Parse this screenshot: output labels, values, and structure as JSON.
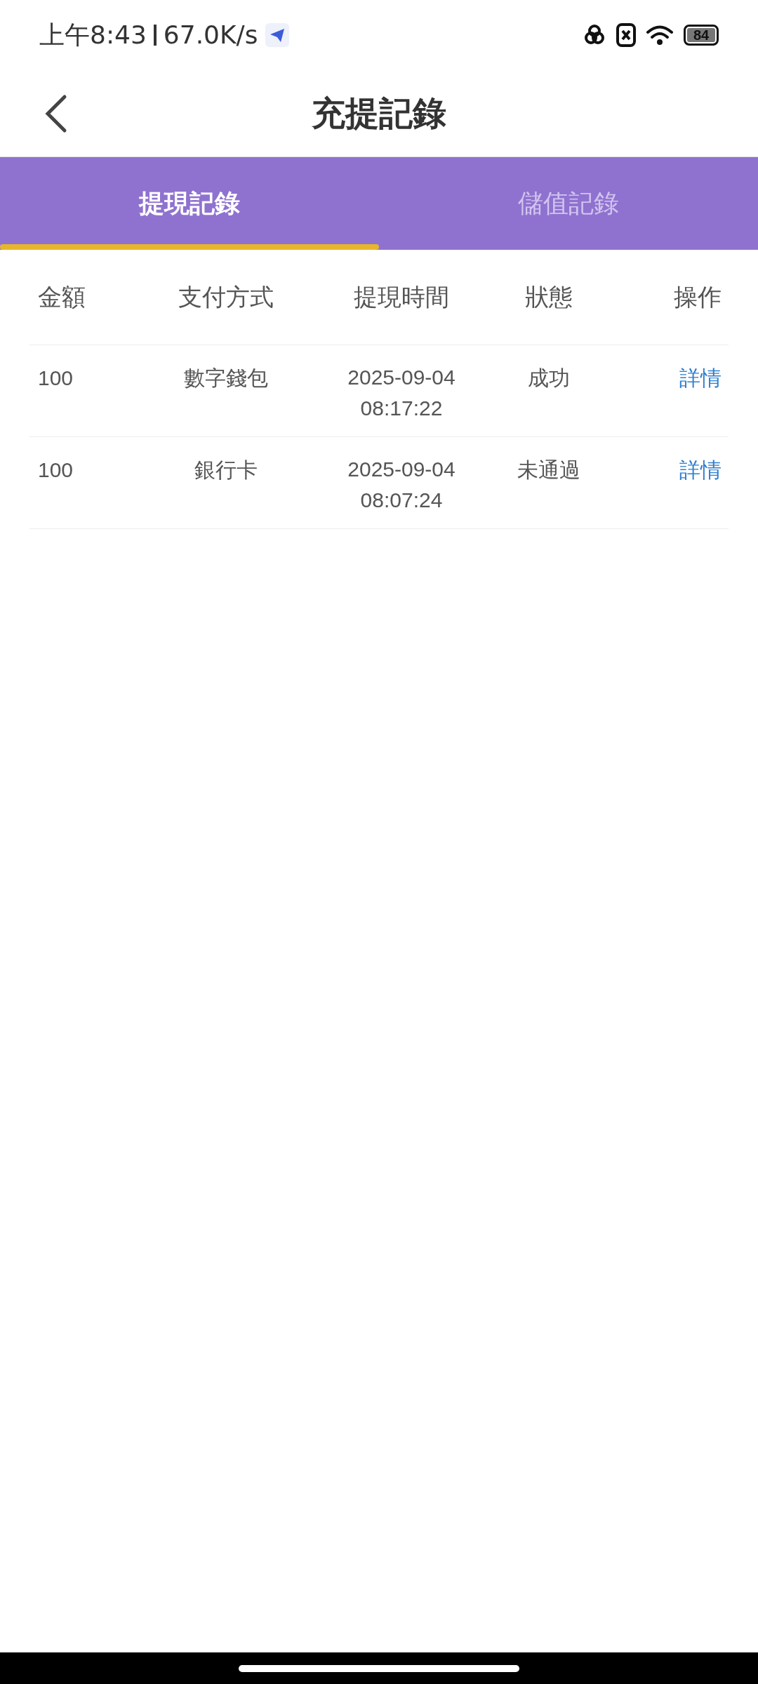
{
  "status_bar": {
    "time": "上午8:43",
    "speed": "67.0K/s",
    "battery": "84"
  },
  "header": {
    "title": "充提記錄"
  },
  "tabs": [
    {
      "label": "提現記錄",
      "selected": true
    },
    {
      "label": "儲值記錄",
      "selected": false
    }
  ],
  "table": {
    "columns": [
      "金額",
      "支付方式",
      "提現時間",
      "狀態",
      "操作"
    ],
    "rows": [
      {
        "amount": "100",
        "method": "數字錢包",
        "time": "2025-09-04 08:17:22",
        "status": "成功",
        "action": "詳情"
      },
      {
        "amount": "100",
        "method": "銀行卡",
        "time": "2025-09-04 08:07:24",
        "status": "未通過",
        "action": "詳情"
      }
    ]
  }
}
